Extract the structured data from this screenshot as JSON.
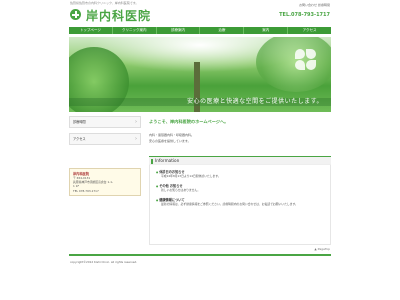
{
  "header": {
    "tagline": "佐賀県佐賀市の内科クリニック、岸内科医院です。",
    "title": "岸内科医院",
    "small_text": "お問い合わせ 診療時間",
    "tel": "TEL.078-793-1717"
  },
  "nav": {
    "items": [
      "トップページ",
      "クリニック案内",
      "診療案内",
      "治療",
      "案内",
      "アクセス"
    ]
  },
  "hero": {
    "slogan": "安心の医療と快適な空間をご提供いたします。"
  },
  "sidebar": {
    "buttons": [
      "診療時間",
      "アクセス"
    ],
    "address": {
      "name": "岸内科医院",
      "lines": [
        "〒 654-0131",
        "兵庫県神戸市須磨区高倉台 1-1-",
        "1 1F",
        "TEL 078-793-1717"
      ]
    }
  },
  "main": {
    "welcome": "ようこそ、岸内科医院のホームページへ。",
    "intro": [
      "内科・循環器内科・呼吸器内科。",
      "安心の医療を提供しています。"
    ],
    "info_heading": "Information",
    "news": [
      {
        "title": "休診日のお知らせ",
        "text": "平成24年8月13日より14日間休診いたします。"
      },
      {
        "title": "その他 お知らせ",
        "text": "新しいお知らせはありません。"
      },
      {
        "title": "健康情報について",
        "text": "最新の情報は、必ず健康情報をご参照ください。診療時間内のお問い合わせは、お電話でお願いいたします。"
      }
    ]
  },
  "footer": {
    "pagetop": "▲ PageTop",
    "copyright": "copyright©2012 Kishi Clinic. all rights reserved."
  },
  "colors": {
    "accent": "#4aa544",
    "nav": "#3c9b36"
  }
}
